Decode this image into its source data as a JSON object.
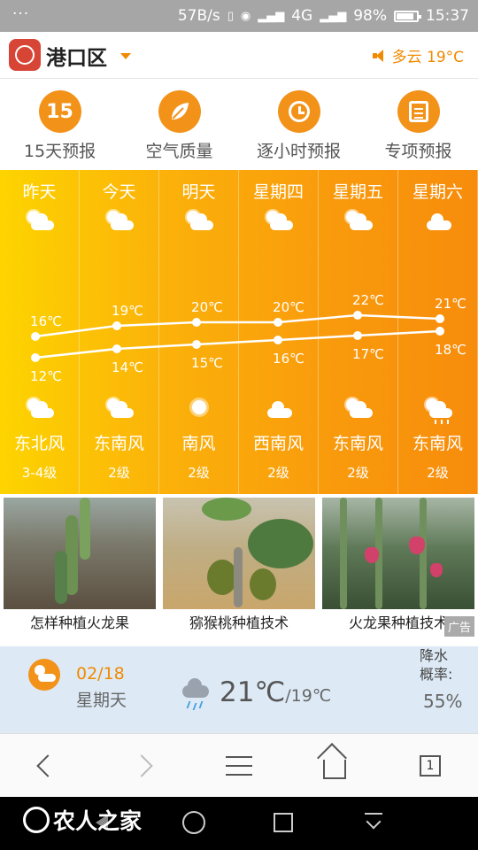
{
  "status_bar": {
    "dots": "···",
    "net_speed": "57B/s",
    "signal_a": "4G",
    "battery": "98%",
    "time": "15:37"
  },
  "header": {
    "city": "港口区",
    "weather": "多云 19°C"
  },
  "menu": [
    {
      "icon": "calendar-15-icon",
      "badge": "15",
      "label": "15天预报"
    },
    {
      "icon": "leaf-icon",
      "label": "空气质量"
    },
    {
      "icon": "clock-icon",
      "label": "逐小时预报"
    },
    {
      "icon": "document-icon",
      "label": "专项预报"
    }
  ],
  "forecast": {
    "days": [
      {
        "day": "昨天",
        "icon": "partly-cloudy-icon",
        "high": 16,
        "low": 12,
        "high_label": "16℃",
        "low_label": "12℃",
        "night_icon": "partly-cloudy-icon",
        "wind": "东北风",
        "level": "3-4级"
      },
      {
        "day": "今天",
        "icon": "partly-cloudy-icon",
        "high": 19,
        "low": 14,
        "high_label": "19℃",
        "low_label": "14℃",
        "night_icon": "partly-cloudy-icon",
        "wind": "东南风",
        "level": "2级"
      },
      {
        "day": "明天",
        "icon": "partly-cloudy-icon",
        "high": 20,
        "low": 15,
        "high_label": "20℃",
        "low_label": "15℃",
        "night_icon": "sunny-icon",
        "wind": "南风",
        "level": "2级"
      },
      {
        "day": "星期四",
        "icon": "partly-cloudy-icon",
        "high": 20,
        "low": 16,
        "high_label": "20℃",
        "low_label": "16℃",
        "night_icon": "cloudy-icon",
        "wind": "西南风",
        "level": "2级"
      },
      {
        "day": "星期五",
        "icon": "partly-cloudy-icon",
        "high": 22,
        "low": 17,
        "high_label": "22℃",
        "low_label": "17℃",
        "night_icon": "partly-cloudy-icon",
        "wind": "东南风",
        "level": "2级"
      },
      {
        "day": "星期六",
        "icon": "cloudy-icon",
        "high": 21,
        "low": 18,
        "high_label": "21℃",
        "low_label": "18℃",
        "night_icon": "sun-shower-icon",
        "wind": "东南风",
        "level": "2级"
      }
    ]
  },
  "ads": {
    "items": [
      {
        "caption": "怎样种植火龙果"
      },
      {
        "caption": "猕猴桃种植技术"
      },
      {
        "caption": "火龙果种植技术"
      }
    ],
    "badge": "广告"
  },
  "today": {
    "date": "02/18",
    "weekday": "星期天",
    "temp_high": "21℃",
    "temp_low": "/19℃",
    "precip_label_1": "降水",
    "precip_label_2": "概率:",
    "precip_value": "55%"
  },
  "browser_nav": {
    "tab_count": "1"
  },
  "watermark": {
    "text": "农人之家"
  },
  "colors": {
    "accent": "#f39219",
    "panel_start": "#fdd400",
    "panel_end": "#f78c0c",
    "today_bg": "#ddeaf6"
  }
}
